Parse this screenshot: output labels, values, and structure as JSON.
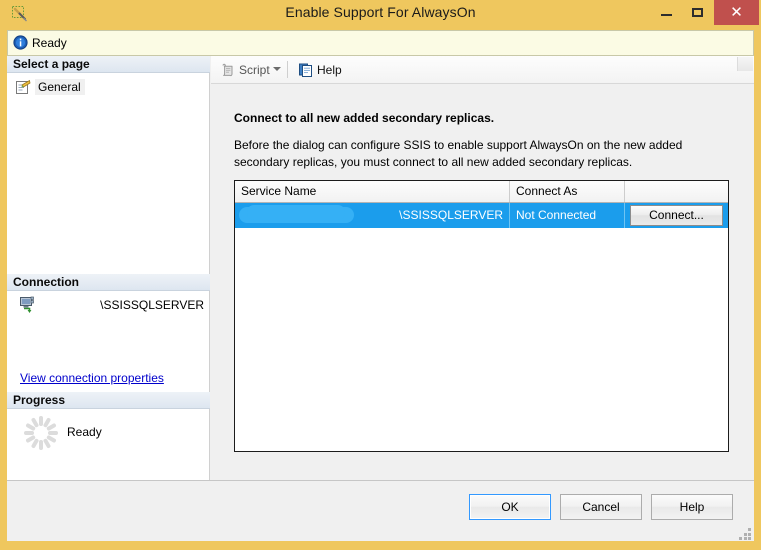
{
  "window": {
    "title": "Enable Support For AlwaysOn",
    "icon": "ssms-tool-icon",
    "controls": {
      "minimize": "–",
      "maximize": "□",
      "close": "✕"
    },
    "accent_titlebar_color": "#efc75e",
    "close_button_color": "#c0504d"
  },
  "infobar": {
    "icon": "info-icon",
    "text": "Ready",
    "background_color": "#fbfbe4"
  },
  "sidebar": {
    "select_page": {
      "header": "Select a page",
      "items": [
        {
          "label": "General",
          "icon": "page-document-icon",
          "selected": true
        }
      ]
    },
    "connection": {
      "header": "Connection",
      "icon": "server-connection-icon",
      "server_name": "\\SSISSQLSERVER",
      "link_label": "View connection properties"
    },
    "progress": {
      "header": "Progress",
      "icon": "spinner-icon",
      "status": "Ready"
    }
  },
  "toolbar": {
    "script": {
      "label": "Script",
      "icon": "script-scroll-icon",
      "enabled": false
    },
    "script_dropdown_icon": "chevron-down-icon",
    "help": {
      "label": "Help",
      "icon": "help-document-icon",
      "enabled": true
    }
  },
  "main": {
    "heading": "Connect to all new added secondary replicas.",
    "description": "Before the dialog can configure SSIS to enable support AlwaysOn on the new added secondary replicas, you must connect to all new added secondary replicas.",
    "grid": {
      "columns": [
        "Service Name",
        "Connect As",
        ""
      ],
      "rows": [
        {
          "service_name": "\\SSISSQLSERVER",
          "service_name_redacted": true,
          "connect_as": "Not Connected",
          "action_label": "Connect...",
          "selected": true,
          "selection_color": "#1b9dec"
        }
      ]
    }
  },
  "footer": {
    "ok_label": "OK",
    "cancel_label": "Cancel",
    "help_label": "Help",
    "focused_button": "OK"
  }
}
